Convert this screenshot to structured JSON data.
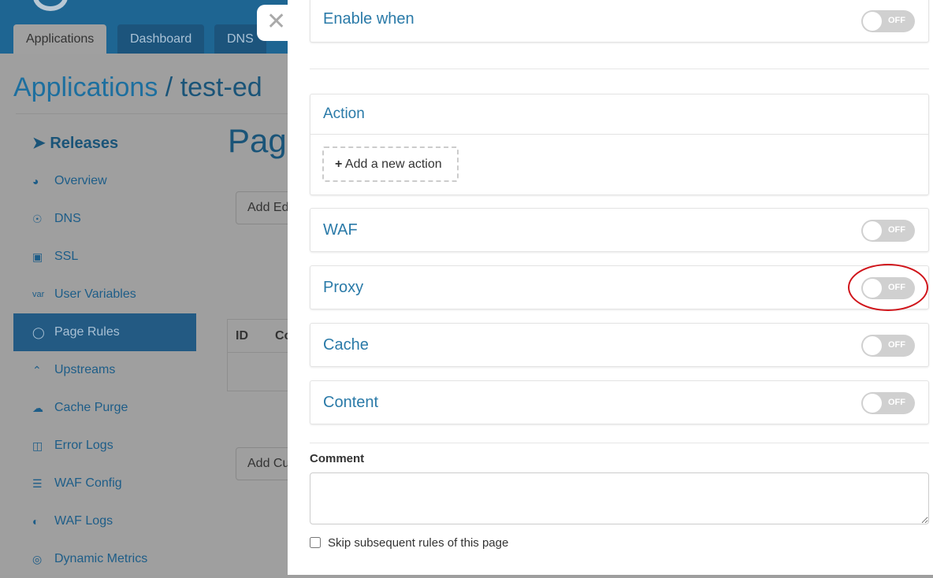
{
  "header": {
    "tabs": [
      {
        "label": "Applications",
        "active": true
      },
      {
        "label": "Dashboard"
      },
      {
        "label": "DNS"
      }
    ]
  },
  "breadcrumb": {
    "root": "Applications",
    "separator": "/",
    "current": "test-ed"
  },
  "sidebar": {
    "section": "Releases",
    "items": [
      {
        "label": "Overview",
        "icon": "gauge-icon"
      },
      {
        "label": "DNS",
        "icon": "globe-icon"
      },
      {
        "label": "SSL",
        "icon": "certificate-icon"
      },
      {
        "label": "User Variables",
        "icon": "var-icon"
      },
      {
        "label": "Page Rules",
        "icon": "compass-icon",
        "active": true
      },
      {
        "label": "Upstreams",
        "icon": "double-chevron-up-icon"
      },
      {
        "label": "Cache Purge",
        "icon": "cloud-icon"
      },
      {
        "label": "Error Logs",
        "icon": "error-log-icon"
      },
      {
        "label": "WAF Config",
        "icon": "list-icon"
      },
      {
        "label": "WAF Logs",
        "icon": "waf-log-icon"
      },
      {
        "label": "Dynamic Metrics",
        "icon": "bulb-icon"
      }
    ]
  },
  "main": {
    "title": "Pag",
    "add_edge_button": "Add Ed",
    "add_custom_button": "Add Cu",
    "table_headers": [
      "ID",
      "Co"
    ]
  },
  "drawer": {
    "enable_when": {
      "title": "Enable when",
      "toggle": "OFF"
    },
    "action": {
      "title": "Action",
      "add_button": "Add a new action"
    },
    "sections": [
      {
        "title": "WAF",
        "toggle": "OFF"
      },
      {
        "title": "Proxy",
        "toggle": "OFF",
        "highlighted": true
      },
      {
        "title": "Cache",
        "toggle": "OFF"
      },
      {
        "title": "Content",
        "toggle": "OFF"
      }
    ],
    "comment_label": "Comment",
    "comment_value": "",
    "skip_label": "Skip subsequent rules of this page",
    "skip_checked": false
  },
  "colors": {
    "header": "#1e6592",
    "accent": "#2a7aa8",
    "highlight_ring": "#d0151b"
  }
}
